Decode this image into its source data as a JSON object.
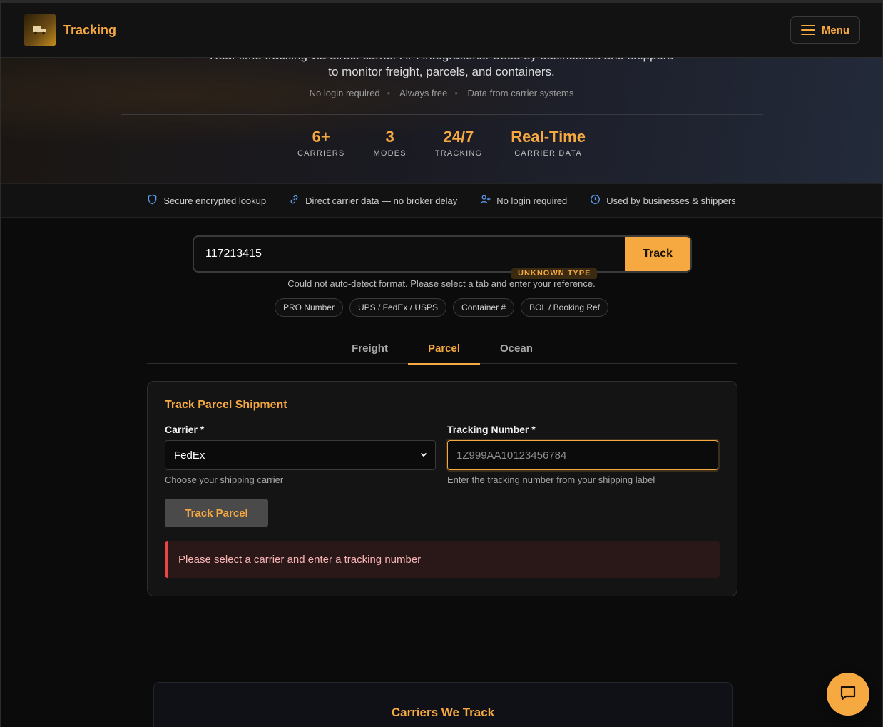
{
  "header": {
    "brand_name": "Tracking",
    "menu_label": "Menu"
  },
  "hero": {
    "description_line1": "Real-time tracking via direct carrier API integrations. Used by businesses and shippers",
    "description_line2": "to monitor freight, parcels, and containers.",
    "tags": [
      "No login required",
      "Always free",
      "Data from carrier systems"
    ],
    "stats": [
      {
        "value": "6+",
        "label": "CARRIERS"
      },
      {
        "value": "3",
        "label": "MODES"
      },
      {
        "value": "24/7",
        "label": "TRACKING"
      },
      {
        "value": "Real-Time",
        "label": "CARRIER DATA"
      }
    ]
  },
  "trust_bar": [
    {
      "icon": "shield-icon",
      "label": "Secure encrypted lookup"
    },
    {
      "icon": "link-icon",
      "label": "Direct carrier data — no broker delay"
    },
    {
      "icon": "user-plus-icon",
      "label": "No login required"
    },
    {
      "icon": "clock-icon",
      "label": "Used by businesses & shippers"
    }
  ],
  "search": {
    "value": "117213415",
    "button_label": "Track",
    "type_badge": "UNKNOWN TYPE",
    "hint": "Could not auto-detect format. Please select a tab and enter your reference.",
    "chips": [
      "PRO Number",
      "UPS / FedEx / USPS",
      "Container #",
      "BOL / Booking Ref"
    ]
  },
  "tabs": [
    {
      "label": "Freight",
      "active": false
    },
    {
      "label": "Parcel",
      "active": true
    },
    {
      "label": "Ocean",
      "active": false
    }
  ],
  "parcel_form": {
    "title": "Track Parcel Shipment",
    "carrier_label": "Carrier *",
    "carrier_value": "FedEx",
    "carrier_help": "Choose your shipping carrier",
    "tracking_label": "Tracking Number *",
    "tracking_placeholder": "1Z999AA10123456784",
    "tracking_help": "Enter the tracking number from your shipping label",
    "submit_label": "Track Parcel",
    "error_message": "Please select a carrier and enter a tracking number"
  },
  "carriers_section": {
    "title": "Carriers We Track"
  },
  "colors": {
    "accent": "#f6a841",
    "background": "#0b0b0c",
    "error": "#ef4444",
    "trust_icon": "#5b9bf0"
  }
}
